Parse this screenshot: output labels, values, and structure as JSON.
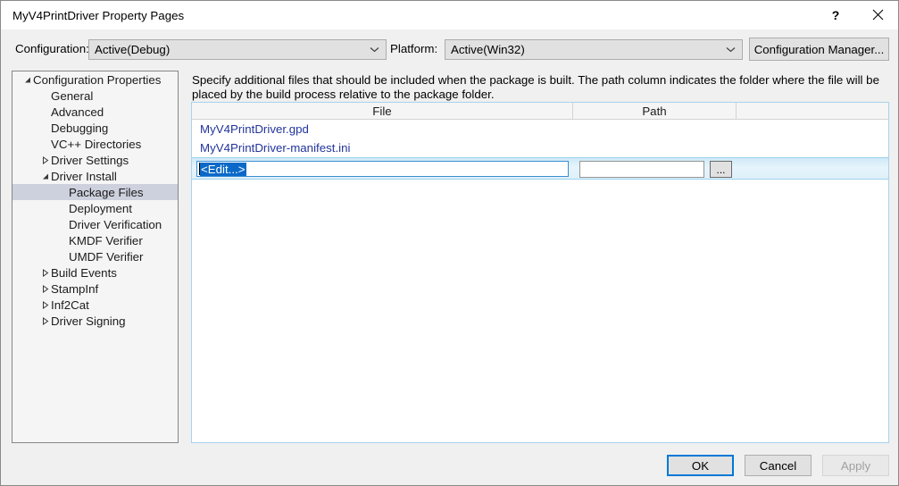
{
  "window": {
    "title": "MyV4PrintDriver Property Pages",
    "help_icon": "?",
    "close_icon": "close-icon"
  },
  "config_bar": {
    "configuration_label": "Configuration:",
    "configuration_value": "Active(Debug)",
    "platform_label": "Platform:",
    "platform_value": "Active(Win32)",
    "configuration_manager_label": "Configuration Manager..."
  },
  "tree": {
    "items": [
      {
        "label": "Configuration Properties",
        "indent": 0,
        "glyph": "expanded",
        "selected": false
      },
      {
        "label": "General",
        "indent": 1,
        "glyph": "none",
        "selected": false
      },
      {
        "label": "Advanced",
        "indent": 1,
        "glyph": "none",
        "selected": false
      },
      {
        "label": "Debugging",
        "indent": 1,
        "glyph": "none",
        "selected": false
      },
      {
        "label": "VC++ Directories",
        "indent": 1,
        "glyph": "none",
        "selected": false
      },
      {
        "label": "Driver Settings",
        "indent": 1,
        "glyph": "collapsed",
        "selected": false
      },
      {
        "label": "Driver Install",
        "indent": 1,
        "glyph": "expanded",
        "selected": false
      },
      {
        "label": "Package Files",
        "indent": 2,
        "glyph": "none",
        "selected": true
      },
      {
        "label": "Deployment",
        "indent": 2,
        "glyph": "none",
        "selected": false
      },
      {
        "label": "Driver Verification",
        "indent": 2,
        "glyph": "none",
        "selected": false
      },
      {
        "label": "KMDF Verifier",
        "indent": 2,
        "glyph": "none",
        "selected": false
      },
      {
        "label": "UMDF Verifier",
        "indent": 2,
        "glyph": "none",
        "selected": false
      },
      {
        "label": "Build Events",
        "indent": 1,
        "glyph": "collapsed",
        "selected": false
      },
      {
        "label": "StampInf",
        "indent": 1,
        "glyph": "collapsed",
        "selected": false
      },
      {
        "label": "Inf2Cat",
        "indent": 1,
        "glyph": "collapsed",
        "selected": false
      },
      {
        "label": "Driver Signing",
        "indent": 1,
        "glyph": "collapsed",
        "selected": false
      }
    ]
  },
  "main": {
    "description": "Specify additional files that should be included when the package is built.  The path column indicates the folder where the file will be placed by the build process relative to the package folder.",
    "grid": {
      "columns": [
        "File",
        "Path",
        ""
      ],
      "rows": [
        {
          "file": "MyV4PrintDriver.gpd",
          "path": ""
        },
        {
          "file": "MyV4PrintDriver-manifest.ini",
          "path": ""
        }
      ],
      "edit_row": {
        "file_value": "<Edit...>",
        "path_value": "",
        "browse_label": "..."
      }
    }
  },
  "footer": {
    "ok_label": "OK",
    "cancel_label": "Cancel",
    "apply_label": "Apply"
  },
  "colors": {
    "accent": "#0078d7",
    "selection": "#0a69c8",
    "link_text": "#22349c",
    "tree_selection": "#cdd1dd",
    "grid_border": "#a8d3ea",
    "window_bg": "#f0f0f0"
  }
}
